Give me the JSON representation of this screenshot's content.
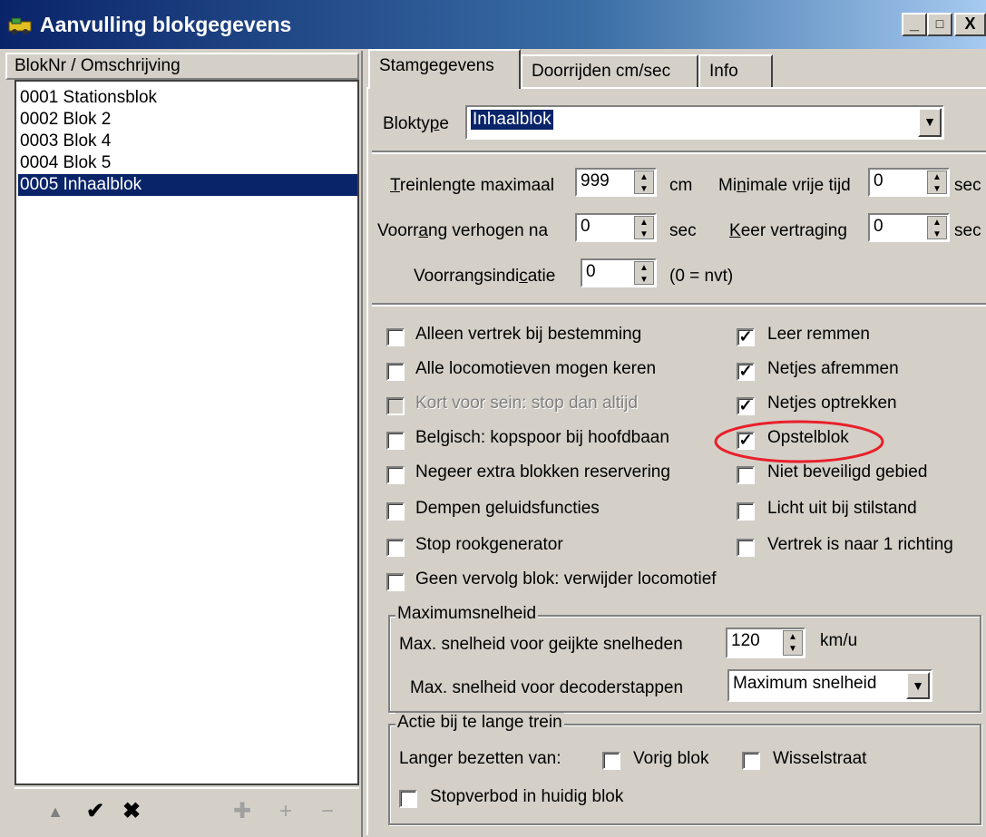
{
  "window": {
    "title": "Aanvulling blokgegevens",
    "controls": [
      "_",
      "□",
      "X"
    ]
  },
  "left": {
    "column_header": "BlokNr / Omschrijving",
    "items": [
      {
        "label": "0001 Stationsblok",
        "selected": false
      },
      {
        "label": "0002 Blok 2",
        "selected": false
      },
      {
        "label": "0003 Blok 4",
        "selected": false
      },
      {
        "label": "0004 Blok 5",
        "selected": false
      },
      {
        "label": "0005 Inhaalblok",
        "selected": true
      }
    ],
    "toolbar": [
      "up-arrow-icon",
      "check-icon",
      "delete-icon",
      "add-multiple-icon",
      "plus-icon",
      "minus-icon"
    ]
  },
  "tabs": [
    {
      "label": "Stamgegevens",
      "active": true
    },
    {
      "label": "Doorrijden cm/sec",
      "active": false
    },
    {
      "label": "Info",
      "active": false
    }
  ],
  "bloktype": {
    "label": "Bloktype",
    "value": "Inhaalblok"
  },
  "fields": {
    "treinlengte": {
      "label": "Treinlengte maximaal",
      "value": "999",
      "unit": "cm"
    },
    "minimale_vrije_tijd": {
      "label": "Minimale vrije tijd",
      "value": "0",
      "unit": "sec"
    },
    "voorrang": {
      "label": "Voorrang verhogen na",
      "value": "0",
      "unit": "sec"
    },
    "keer_vertraging": {
      "label": "Keer vertraging",
      "value": "0",
      "unit": "sec"
    },
    "voorrangsindicatie": {
      "label": "Voorrangsindicatie",
      "value": "0",
      "unit": "(0 = nvt)"
    }
  },
  "checks_left": [
    {
      "label": "Alleen vertrek bij bestemming",
      "checked": false,
      "disabled": false
    },
    {
      "label": "Alle locomotieven mogen keren",
      "checked": false,
      "disabled": false
    },
    {
      "label": "Kort voor sein: stop dan altijd",
      "checked": false,
      "disabled": true
    },
    {
      "label": "Belgisch: kopspoor bij hoofdbaan",
      "checked": false,
      "disabled": false
    },
    {
      "label": "Negeer extra blokken reservering",
      "checked": false,
      "disabled": false
    },
    {
      "label": "Dempen geluidsfuncties",
      "checked": false,
      "disabled": false
    },
    {
      "label": "Stop rookgenerator",
      "checked": false,
      "disabled": false
    },
    {
      "label": "Geen vervolg blok: verwijder locomotief",
      "checked": false,
      "disabled": false
    }
  ],
  "checks_right": [
    {
      "label": "Leer remmen",
      "checked": true
    },
    {
      "label": "Netjes afremmen",
      "checked": true
    },
    {
      "label": "Netjes optrekken",
      "checked": true
    },
    {
      "label": "Opstelblok",
      "checked": true
    },
    {
      "label": "Niet beveiligd gebied",
      "checked": false
    },
    {
      "label": "Licht uit bij stilstand",
      "checked": false
    },
    {
      "label": "Vertrek is naar 1 richting",
      "checked": false
    }
  ],
  "max_speed": {
    "title": "Maximumsnelheid",
    "geijkte_label": "Max. snelheid voor geijkte snelheden",
    "geijkte_value": "120",
    "unit": "km/u",
    "decoder_label": "Max. snelheid voor decoderstappen",
    "decoder_value": "Maximum snelheid"
  },
  "long_train": {
    "title": "Actie bij te lange trein",
    "langer_label": "Langer bezetten van:",
    "vorig_label": "Vorig blok",
    "vorig_checked": false,
    "wissel_label": "Wisselstraat",
    "wissel_checked": false,
    "stopverbod_label": "Stopverbod in huidig blok",
    "stopverbod_checked": false
  },
  "highlight_color": "#e8202a",
  "selection_color": "#0a246a"
}
